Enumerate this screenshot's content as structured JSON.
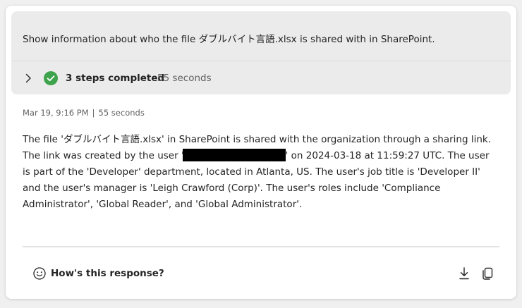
{
  "prompt": {
    "text": "Show information about who the file ダブルバイト言語.xlsx is shared with in SharePoint."
  },
  "steps": {
    "label": "3 steps completed",
    "duration": "55 seconds",
    "expand_icon": "chevron-right-icon",
    "status_icon": "check-circle-icon",
    "status_color": "#2ea44f"
  },
  "meta": {
    "timestamp": "Mar 19, 9:16 PM",
    "separator": "|",
    "duration": "55 seconds"
  },
  "response": {
    "part1": "The file 'ダブルバイト言語.xlsx' in SharePoint is shared with the organization through a sharing link. The link was created by the user '",
    "part2": "' on 2024-03-18 at 11:59:27 UTC. The user is part of the 'Developer' department, located in Atlanta, US. The user's job title is 'Developer II' and the user's manager is 'Leigh Crawford (Corp)'. The user's roles include 'Compliance Administrator', 'Global Reader', and 'Global Administrator'."
  },
  "footer": {
    "feedback_label": "How's this response?",
    "feedback_icon": "smile-icon",
    "download_icon": "download-icon",
    "copy_icon": "copy-icon"
  }
}
